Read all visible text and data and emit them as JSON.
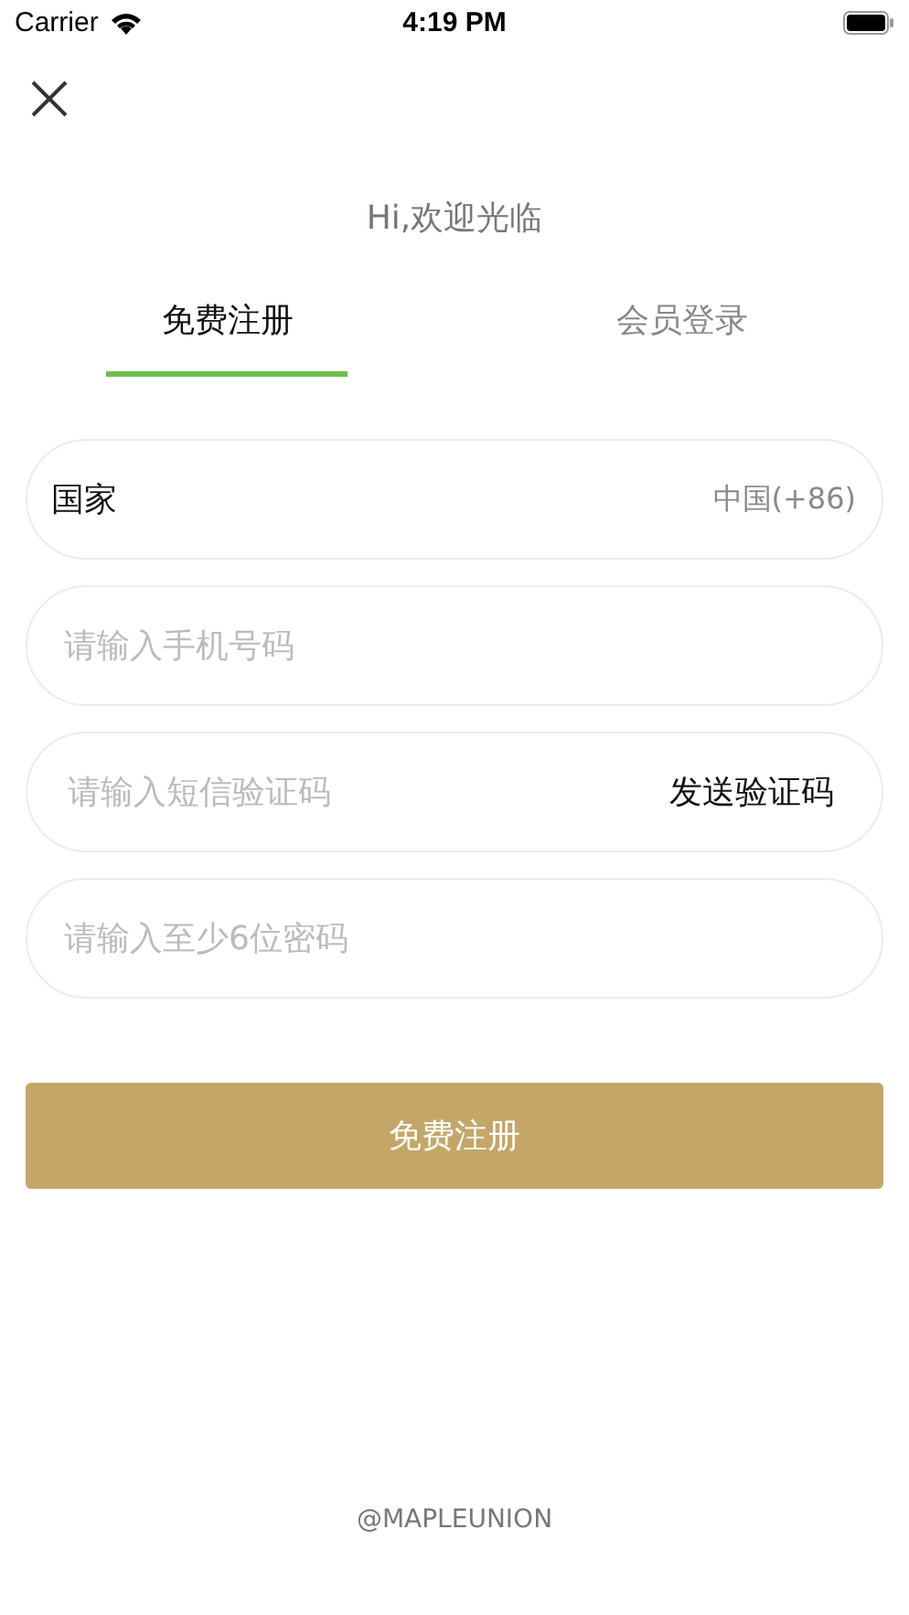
{
  "status_bar": {
    "carrier": "Carrier",
    "time": "4:19 PM"
  },
  "greeting": "Hi,欢迎光临",
  "tabs": [
    {
      "label": "免费注册",
      "selected": true
    },
    {
      "label": "会员登录",
      "selected": false
    }
  ],
  "fields": [
    {
      "kind": "select",
      "label": "国家",
      "value": "中国(+86)"
    },
    {
      "kind": "text",
      "placeholder": "请输入手机号码"
    },
    {
      "kind": "code",
      "placeholder": "请输入短信验证码",
      "action": "发送验证码"
    },
    {
      "kind": "password",
      "placeholder": "请输入至少6位密码"
    }
  ],
  "submit": "免费注册",
  "footer": "@MAPLEUNION"
}
